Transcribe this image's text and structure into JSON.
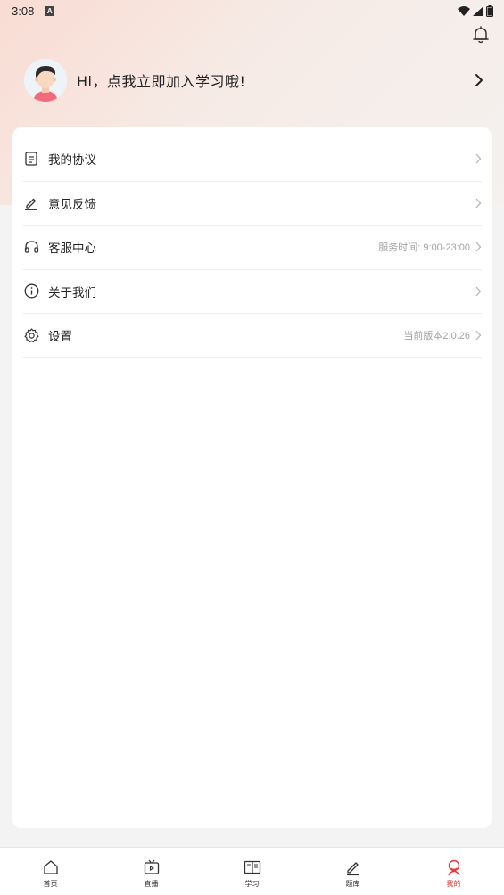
{
  "status_bar": {
    "time": "3:08",
    "notification_icon": "a-badge-icon",
    "icons": [
      "wifi-icon",
      "signal-icon",
      "battery-icon"
    ]
  },
  "header": {
    "bell_icon": "bell-icon",
    "greeting": "Hi，点我立即加入学习哦!",
    "avatar_icon": "avatar-icon"
  },
  "menu": {
    "items": [
      {
        "label": "我的协议",
        "icon": "document-icon",
        "right_text": ""
      },
      {
        "label": "意见反馈",
        "icon": "pencil-icon",
        "right_text": ""
      },
      {
        "label": "客服中心",
        "icon": "headset-icon",
        "right_text": "服务时间: 9:00-23:00"
      },
      {
        "label": "关于我们",
        "icon": "info-icon",
        "right_text": ""
      },
      {
        "label": "设置",
        "icon": "gear-icon",
        "right_text": "当前版本2.0.26"
      }
    ]
  },
  "tabbar": {
    "tabs": [
      {
        "label": "首页",
        "icon": "home-icon",
        "active": false
      },
      {
        "label": "直播",
        "icon": "tv-icon",
        "active": false
      },
      {
        "label": "学习",
        "icon": "book-icon",
        "active": false
      },
      {
        "label": "题库",
        "icon": "pencil-icon",
        "active": false
      },
      {
        "label": "我的",
        "icon": "user-icon",
        "active": true
      }
    ]
  },
  "colors": {
    "accent": "#e03a3a",
    "header_gradient_start": "#f9dcd3",
    "header_gradient_end": "#f4f1ef",
    "secondary_text": "#a3a3a3"
  }
}
